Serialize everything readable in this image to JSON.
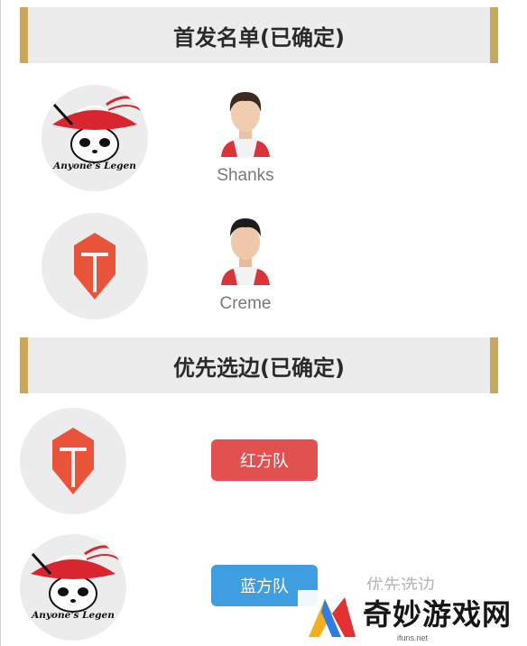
{
  "sections": {
    "starters_title": "首发名单(已确定)",
    "side_title": "优先选边(已确定)"
  },
  "teams": {
    "al_logo_text": "Anyone's Legen"
  },
  "players": [
    {
      "name": "Shanks"
    },
    {
      "name": "Creme"
    }
  ],
  "side_buttons": {
    "red_label": "红方队",
    "blue_label": "蓝方队"
  },
  "ghost_text": "优先选边",
  "watermark": {
    "brand": "奇妙游戏网",
    "url": "ifuns.net"
  },
  "colors": {
    "banner_accent": "#c8a75e",
    "red_side": "#e1514f",
    "blue_side": "#3f9ee0",
    "tes_logo": "#e9533a"
  },
  "icons": [
    "anyones-legend-logo-icon",
    "tes-logo-icon",
    "player-avatar-icon",
    "watermark-logo-icon"
  ]
}
